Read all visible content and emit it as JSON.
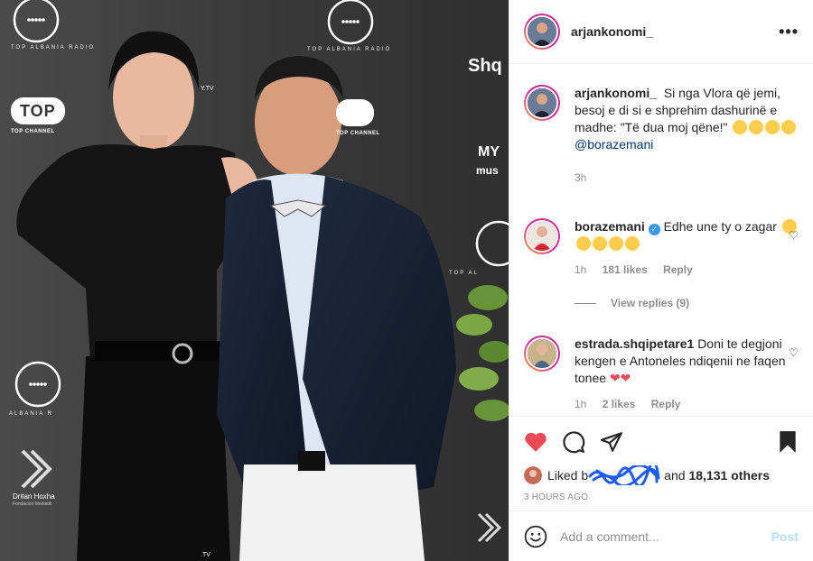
{
  "photo": {
    "brands": {
      "top_channel": "TOP",
      "top_channel_sub": "TOP CHANNEL",
      "albania_radio": "TOP ALBANIA RADIO",
      "albania_radio_left": "ALBANIA R",
      "shq": "Shq",
      "my": "MY",
      "mus": "mus",
      "topal": "TOP AL",
      "dritan": "Dritan Hoxha",
      "dritan_sub": "Fondacion Mediatik",
      "tv": "Y.TV",
      "tv2": ".TV"
    }
  },
  "header": {
    "username": "arjankonomi_",
    "more_icon": "more-dots-icon"
  },
  "caption": {
    "username": "arjankonomi_",
    "text": "Si nga Vlora që jemi, besoj e di si e shprehim dashurinë e madhe: \"Të dua moj qëne!\"",
    "mention": "@borazemani",
    "time": "3h"
  },
  "comments": [
    {
      "username": "borazemani",
      "text": "Edhe une ty o zagar",
      "time": "1h",
      "likes": "181 likes",
      "reply": "Reply",
      "view_replies": "View replies (9)"
    },
    {
      "username": "estrada.shqipetare1",
      "text": "Doni te degjoni kengen e Antoneles ndiqenii ne faqen tonee",
      "time": "1h",
      "likes": "2 likes",
      "reply": "Reply"
    }
  ],
  "actions": {
    "liked_by_prefix": "Liked b",
    "liked_by_suffix": "and",
    "others": "18,131 others",
    "timestamp": "3 HOURS AGO"
  },
  "add_comment": {
    "placeholder": "Add a comment...",
    "post_label": "Post"
  },
  "colors": {
    "like_red": "#ed4956",
    "link_blue": "#00376b",
    "post_disabled": "#b2dffc",
    "scribble_blue": "#1e5bff"
  }
}
